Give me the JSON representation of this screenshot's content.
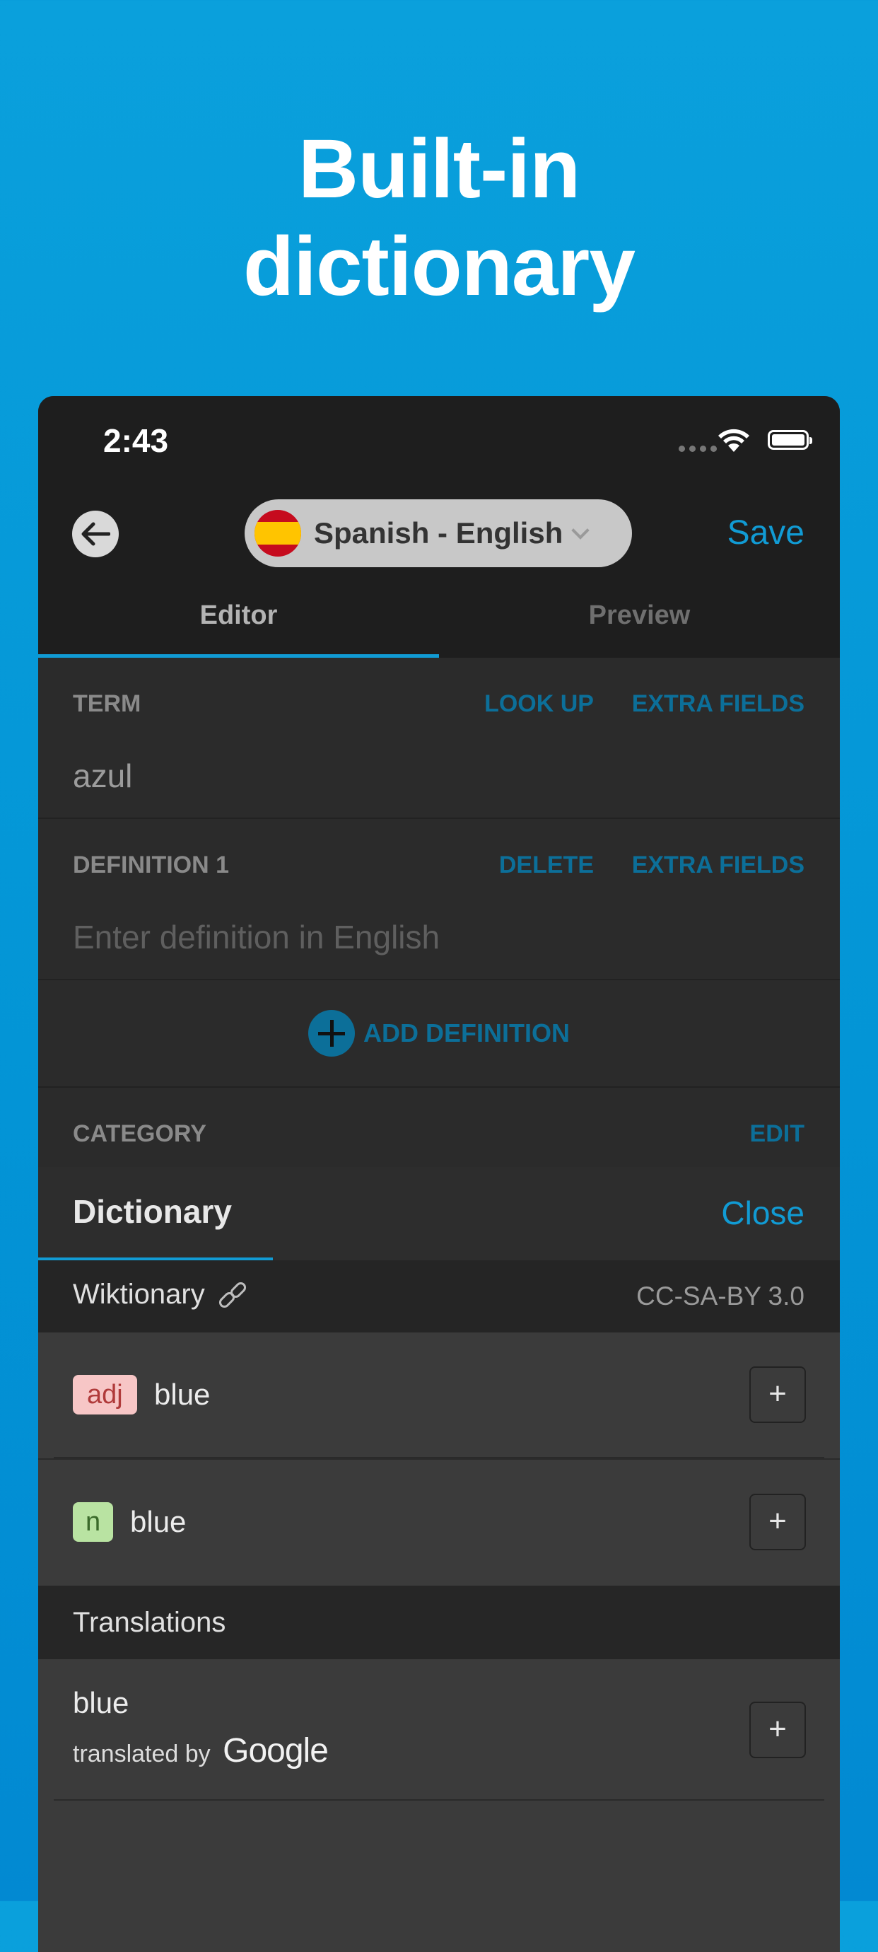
{
  "headline": {
    "line1": "Built-in",
    "line2": "dictionary"
  },
  "status_bar": {
    "time": "2:43"
  },
  "nav": {
    "back_icon": "arrow-left-icon",
    "language_pair": "Spanish - English",
    "flag": "spain-flag-icon",
    "save_label": "Save"
  },
  "tabs": {
    "editor": "Editor",
    "preview": "Preview"
  },
  "term": {
    "label": "TERM",
    "look_up": "LOOK UP",
    "extra_fields": "EXTRA FIELDS",
    "value": "azul"
  },
  "definition": {
    "label": "DEFINITION 1",
    "delete": "DELETE",
    "extra_fields": "EXTRA FIELDS",
    "placeholder": "Enter definition in English"
  },
  "add_definition": "ADD DEFINITION",
  "category": {
    "label": "CATEGORY",
    "edit": "EDIT"
  },
  "dictionary": {
    "title": "Dictionary",
    "close": "Close",
    "source": "Wiktionary",
    "license": "CC-SA-BY 3.0",
    "entries": [
      {
        "pos": "adj",
        "word": "blue",
        "add": "+"
      },
      {
        "pos": "n",
        "word": "blue",
        "add": "+"
      }
    ]
  },
  "translations": {
    "title": "Translations",
    "word": "blue",
    "translated_by": "translated by",
    "provider": "Google",
    "add": "+"
  },
  "colors": {
    "background": "#0395d6",
    "accent": "#119bd4",
    "panel": "#2b2b2b",
    "adj_badge": "#f7c6c6",
    "n_badge": "#b9e3a2"
  }
}
